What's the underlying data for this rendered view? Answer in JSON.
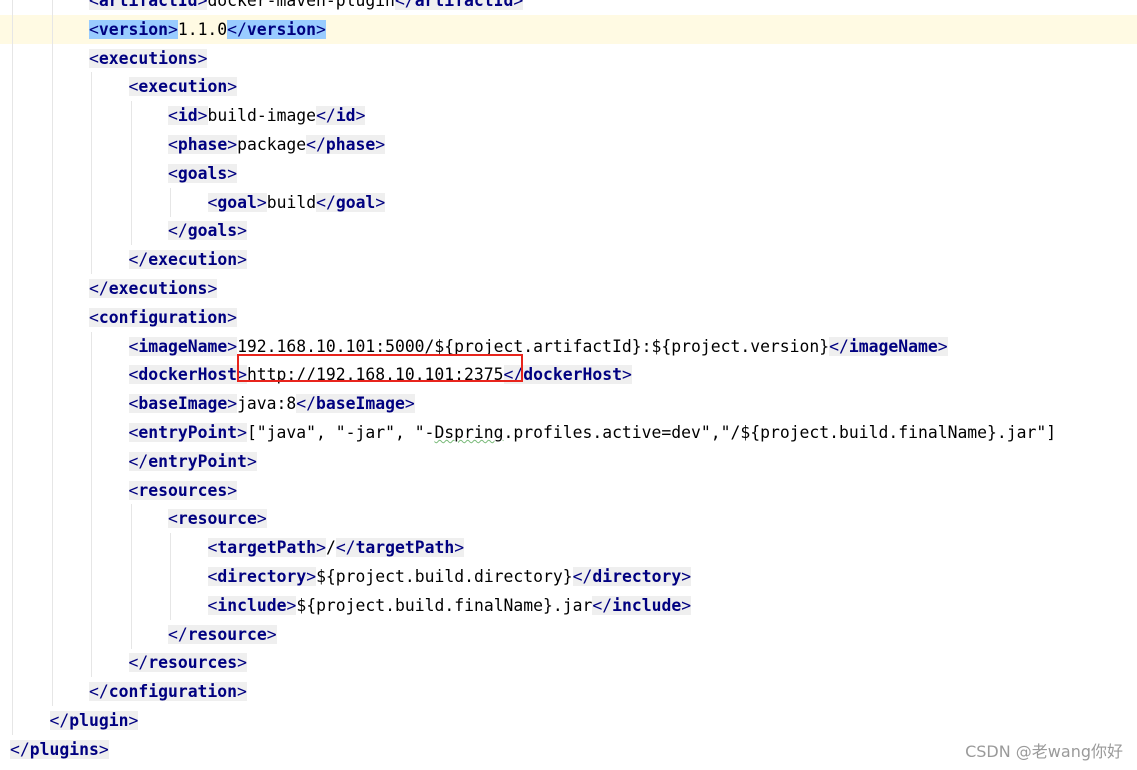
{
  "editor": {
    "highlight_line": 1,
    "lines": [
      {
        "indent": 2,
        "parts": [
          {
            "t": "tag",
            "v": "<artifactId>"
          },
          {
            "t": "txt",
            "v": "docker-maven-plugin"
          },
          {
            "t": "tag",
            "v": "</artifactId>"
          }
        ]
      },
      {
        "indent": 2,
        "parts": [
          {
            "t": "tag",
            "v": "<version>",
            "match": true
          },
          {
            "t": "txt",
            "v": "1.1.0"
          },
          {
            "t": "tag",
            "v": "</version>",
            "match": true
          }
        ]
      },
      {
        "indent": 2,
        "parts": [
          {
            "t": "tag",
            "v": "<executions>"
          }
        ]
      },
      {
        "indent": 3,
        "parts": [
          {
            "t": "tag",
            "v": "<execution>"
          }
        ]
      },
      {
        "indent": 4,
        "parts": [
          {
            "t": "tag",
            "v": "<id>"
          },
          {
            "t": "txt",
            "v": "build-image"
          },
          {
            "t": "tag",
            "v": "</id>"
          }
        ]
      },
      {
        "indent": 4,
        "parts": [
          {
            "t": "tag",
            "v": "<phase>"
          },
          {
            "t": "txt",
            "v": "package"
          },
          {
            "t": "tag",
            "v": "</phase>"
          }
        ]
      },
      {
        "indent": 4,
        "parts": [
          {
            "t": "tag",
            "v": "<goals>"
          }
        ]
      },
      {
        "indent": 5,
        "parts": [
          {
            "t": "tag",
            "v": "<goal>"
          },
          {
            "t": "txt",
            "v": "build"
          },
          {
            "t": "tag",
            "v": "</goal>"
          }
        ]
      },
      {
        "indent": 4,
        "parts": [
          {
            "t": "tag",
            "v": "</goals>"
          }
        ]
      },
      {
        "indent": 3,
        "parts": [
          {
            "t": "tag",
            "v": "</execution>"
          }
        ]
      },
      {
        "indent": 2,
        "parts": [
          {
            "t": "tag",
            "v": "</executions>"
          }
        ]
      },
      {
        "indent": 2,
        "parts": [
          {
            "t": "tag",
            "v": "<configuration>"
          }
        ]
      },
      {
        "indent": 3,
        "parts": [
          {
            "t": "tag",
            "v": "<imageName>"
          },
          {
            "t": "txt",
            "v": "192.168.10.101:5000/${project.artifactId}:${project.version}"
          },
          {
            "t": "tag",
            "v": "</imageName>"
          }
        ]
      },
      {
        "indent": 3,
        "parts": [
          {
            "t": "tag",
            "v": "<dockerHost>"
          },
          {
            "t": "txt",
            "v": "http://192.168.10.101:2375"
          },
          {
            "t": "tag",
            "v": "</dockerHost>"
          }
        ]
      },
      {
        "indent": 3,
        "parts": [
          {
            "t": "tag",
            "v": "<baseImage>"
          },
          {
            "t": "txt",
            "v": "java:8"
          },
          {
            "t": "tag",
            "v": "</baseImage>"
          }
        ]
      },
      {
        "indent": 3,
        "parts": [
          {
            "t": "tag",
            "v": "<entryPoint>"
          },
          {
            "t": "txt",
            "v": "[\"java\", \"-jar\", \"-"
          },
          {
            "t": "typo",
            "v": "Dspring"
          },
          {
            "t": "txt",
            "v": ".profiles.active=dev\",\"/${project.build.finalName}.jar\"]"
          }
        ]
      },
      {
        "indent": 3,
        "parts": [
          {
            "t": "tag",
            "v": "</entryPoint>"
          }
        ]
      },
      {
        "indent": 3,
        "parts": [
          {
            "t": "tag",
            "v": "<resources>"
          }
        ]
      },
      {
        "indent": 4,
        "parts": [
          {
            "t": "tag",
            "v": "<resource>"
          }
        ]
      },
      {
        "indent": 5,
        "parts": [
          {
            "t": "tag",
            "v": "<targetPath>"
          },
          {
            "t": "txt",
            "v": "/"
          },
          {
            "t": "tag",
            "v": "</targetPath>"
          }
        ]
      },
      {
        "indent": 5,
        "parts": [
          {
            "t": "tag",
            "v": "<directory>"
          },
          {
            "t": "txt",
            "v": "${project.build.directory}"
          },
          {
            "t": "tag",
            "v": "</directory>"
          }
        ]
      },
      {
        "indent": 5,
        "parts": [
          {
            "t": "tag",
            "v": "<include>"
          },
          {
            "t": "txt",
            "v": "${project.build.finalName}.jar"
          },
          {
            "t": "tag",
            "v": "</include>"
          }
        ]
      },
      {
        "indent": 4,
        "parts": [
          {
            "t": "tag",
            "v": "</resource>"
          }
        ]
      },
      {
        "indent": 3,
        "parts": [
          {
            "t": "tag",
            "v": "</resources>"
          }
        ]
      },
      {
        "indent": 2,
        "parts": [
          {
            "t": "tag",
            "v": "</configuration>"
          }
        ]
      },
      {
        "indent": 1,
        "parts": [
          {
            "t": "tag",
            "v": "</plugin>"
          }
        ]
      },
      {
        "indent": 0,
        "parts": [
          {
            "t": "tag",
            "v": "</plugins>"
          }
        ]
      }
    ]
  },
  "watermark": "CSDN @老wang你好",
  "colors": {
    "tag_name": "#000080",
    "tag_background": "#efefef",
    "brace_match": "#99ccff",
    "current_line": "#fffae3",
    "annotation_box": "#e8241c"
  }
}
